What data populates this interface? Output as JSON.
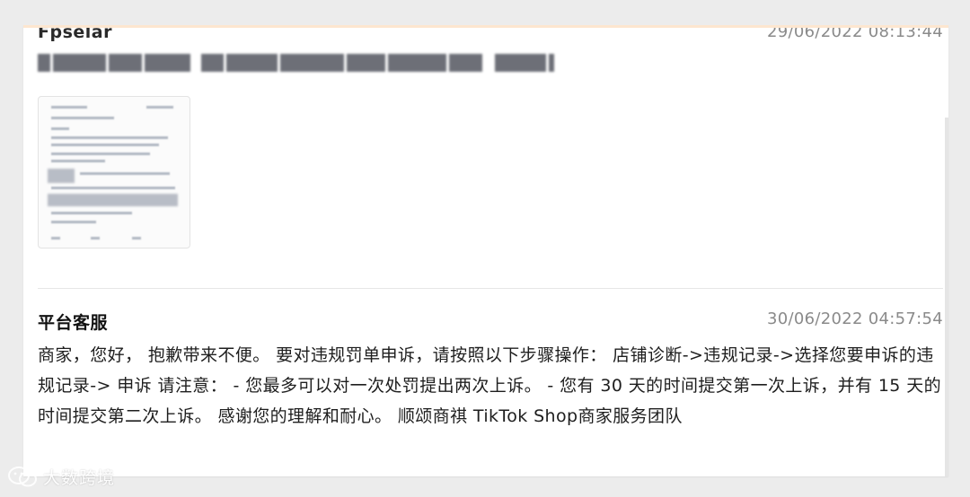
{
  "messages": [
    {
      "sender": "Fpselar",
      "timestamp": "29/06/2022 08:13:44",
      "has_blurred_text": true,
      "has_attachment": true
    },
    {
      "sender": "平台客服",
      "timestamp": "30/06/2022 04:57:54",
      "body": "商家，您好， 抱歉带来不便。 要对违规罚单申诉，请按照以下步骤操作： 店铺诊断->违规记录->选择您要申诉的违规记录-> 申诉 请注意： - 您最多可以对一次处罚提出两次上诉。 - 您有 30 天的时间提交第一次上诉，并有 15 天的时间提交第二次上诉。 感谢您的理解和耐心。 顺颂商祺 TikTok Shop商家服务团队"
    }
  ],
  "watermark": {
    "icon": "wechat-logo-icon",
    "text": "大数跨境"
  },
  "colors": {
    "page_bg": "#ececec",
    "card_bg": "#ffffff",
    "top_accent": "#fde6cf",
    "timestamp": "#8a8a8a",
    "body_text": "#1e1e1e"
  }
}
